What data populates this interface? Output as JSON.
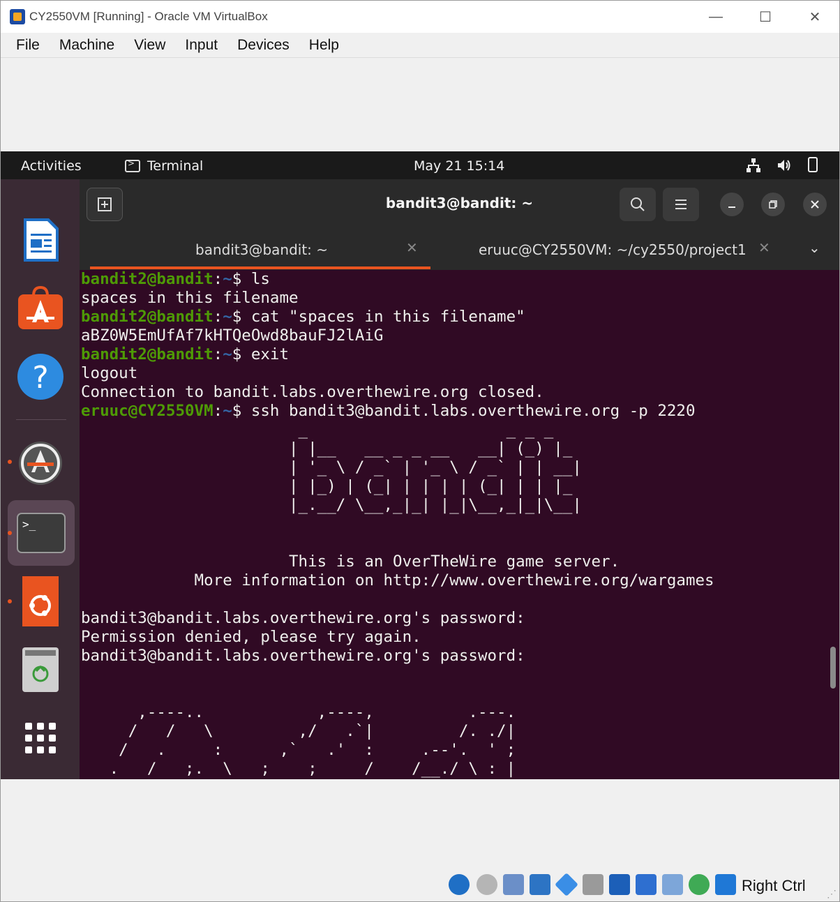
{
  "window": {
    "title": "CY2550VM [Running] - Oracle VM VirtualBox",
    "controls": {
      "minimize": "—",
      "maximize": "☐",
      "close": "✕"
    }
  },
  "menubar": [
    "File",
    "Machine",
    "View",
    "Input",
    "Devices",
    "Help"
  ],
  "ubuntu": {
    "activities": "Activities",
    "app_name": "Terminal",
    "clock": "May 21  15:14"
  },
  "terminal": {
    "title": "bandit3@bandit: ~",
    "tabs": [
      {
        "label": "bandit3@bandit: ~",
        "active": true
      },
      {
        "label": "eruuc@CY2550VM: ~/cy2550/project1",
        "active": false
      }
    ],
    "lines": [
      {
        "user": "bandit2@bandit",
        "path": "~",
        "cmd": "$ ls"
      },
      {
        "text": "spaces in this filename"
      },
      {
        "user": "bandit2@bandit",
        "path": "~",
        "cmd": "$ cat \"spaces in this filename\""
      },
      {
        "text": "aBZ0W5EmUfAf7kHTQeOwd8bauFJ2lAiG"
      },
      {
        "user": "bandit2@bandit",
        "path": "~",
        "cmd": "$ exit"
      },
      {
        "text": "logout"
      },
      {
        "text": "Connection to bandit.labs.overthewire.org closed."
      },
      {
        "user": "eruuc@CY2550VM",
        "path": "~",
        "cmd": "$ ssh bandit3@bandit.labs.overthewire.org -p 2220"
      },
      {
        "text": "                       _                     _ _ _   "
      },
      {
        "text": "                      | |__   __ _ _ __   __| (_) |_ "
      },
      {
        "text": "                      | '_ \\ / _` | '_ \\ / _` | | __|"
      },
      {
        "text": "                      | |_) | (_| | | | | (_| | | |_ "
      },
      {
        "text": "                      |_.__/ \\__,_|_| |_|\\__,_|_|\\__|"
      },
      {
        "text": ""
      },
      {
        "text": ""
      },
      {
        "text": "                      This is an OverTheWire game server."
      },
      {
        "text": "            More information on http://www.overthewire.org/wargames"
      },
      {
        "text": ""
      },
      {
        "text": "bandit3@bandit.labs.overthewire.org's password:"
      },
      {
        "text": "Permission denied, please try again."
      },
      {
        "text": "bandit3@bandit.labs.overthewire.org's password:"
      },
      {
        "text": ""
      },
      {
        "text": ""
      },
      {
        "text": "      ,----..            ,----,          .---."
      },
      {
        "text": "     /   /   \\         ,/   .`|         /. ./|"
      },
      {
        "text": "    /   .     :      ,`   .'  :     .--'.  ' ;"
      },
      {
        "text": "   .   /   ;.  \\   ;    ;     /    /__./ \\ : |"
      },
      {
        "text": "  .   ;   /  ` ; .'___,/    ,' .--'.  '   \\' ."
      }
    ]
  },
  "statusbar": {
    "host_key": "Right Ctrl"
  }
}
